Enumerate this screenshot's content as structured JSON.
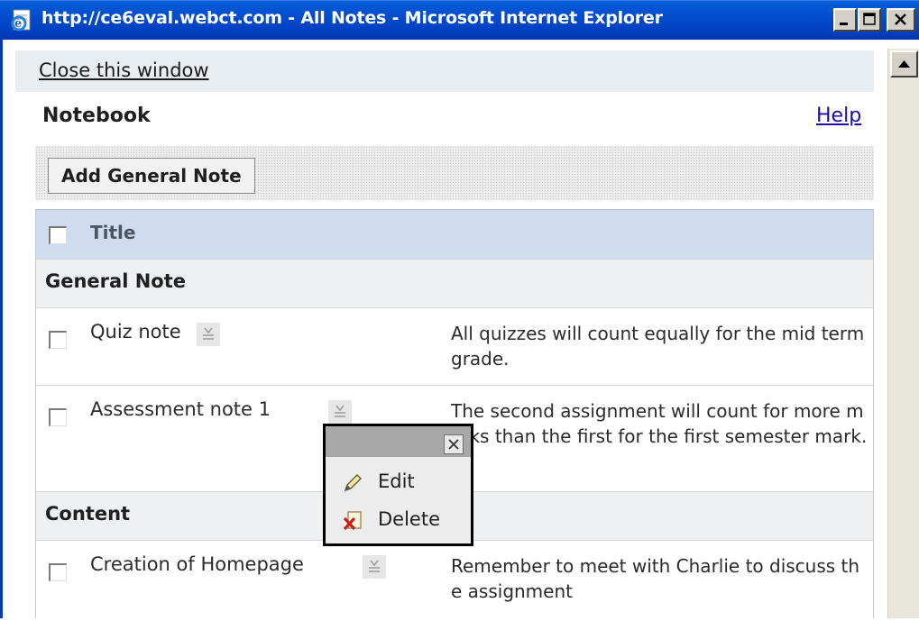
{
  "window": {
    "title": "http://ce6eval.webct.com - All Notes - Microsoft Internet Explorer",
    "app_icon": "ie-page-icon",
    "minimize_icon": "minimize-icon",
    "maximize_icon": "maximize-icon",
    "close_icon": "close-icon"
  },
  "page": {
    "close_window_link": "Close this window",
    "title": "Notebook",
    "help_link": "Help",
    "add_button": "Add General Note"
  },
  "table": {
    "header_title": "Title",
    "groups": [
      {
        "label": "General Note",
        "rows": [
          {
            "title": "Quiz note",
            "description": "All quizzes will count equally for the mid term grade."
          },
          {
            "title": "Assessment note 1",
            "description": "The second assignment will count for more marks than the first for the first semester mark."
          }
        ]
      },
      {
        "label": "Content",
        "rows": [
          {
            "title": "Creation of Homepage",
            "description": "Remember to meet with Charlie to discuss the assignment"
          }
        ]
      }
    ]
  },
  "popup_menu": {
    "items": [
      {
        "label": "Edit",
        "icon": "pencil-icon"
      },
      {
        "label": "Delete",
        "icon": "delete-icon"
      }
    ]
  },
  "colors": {
    "titlebar": "#0350d2",
    "header_row": "#cfdcef",
    "link": "#1a0dab"
  }
}
